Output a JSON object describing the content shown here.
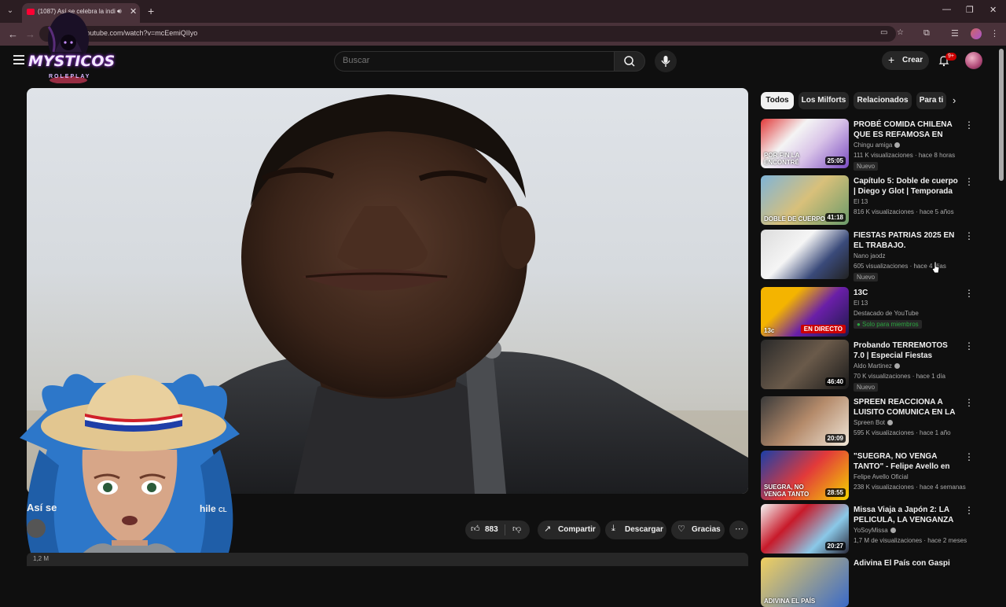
{
  "browser": {
    "tab_title": "(1087) Así se celebra la indi",
    "url": "youtube.com/watch?v=mcEemiQIIyo"
  },
  "overlay_logo": {
    "title": "MYSTICOS",
    "subtitle": "ROLEPLAY"
  },
  "header": {
    "search_placeholder": "Buscar",
    "create_label": "Crear",
    "notification_count": "9+"
  },
  "video": {
    "title_start": "Así se",
    "title_end": "hile",
    "title_tail_badge": "CL",
    "likes": "883",
    "share_label": "Compartir",
    "download_label": "Descargar",
    "thanks_label": "Gracias",
    "description_snippet": "1,2 M"
  },
  "chips": [
    "Todos",
    "Los Milforts",
    "Relacionados",
    "Para ti"
  ],
  "recommendations": [
    {
      "title": "PROBÉ COMIDA CHILENA QUE ES REFAMOSA EN COREA! Y ...",
      "channel": "Chingu amiga",
      "verified": true,
      "meta": "111 K visualizaciones · hace 8 horas",
      "duration": "25:05",
      "badge": "Nuevo",
      "thumb_text": "POR FIN LA ENCONTRÉ"
    },
    {
      "title": "Capítulo 5: Doble de cuerpo | Diego y Glot | Temporada 2005",
      "channel": "El 13",
      "verified": false,
      "meta": "816 K visualizaciones · hace 5 años",
      "duration": "41:18",
      "badge": "",
      "thumb_text": "DOBLE DE CUERPO"
    },
    {
      "title": "FIESTAS PATRIAS 2025 EN EL TRABAJO.",
      "channel": "Nano jaodz",
      "verified": false,
      "meta": "605 visualizaciones · hace 4 días",
      "duration": "",
      "badge": "Nuevo",
      "thumb_text": ""
    },
    {
      "title": "13C",
      "channel": "El 13",
      "verified": false,
      "meta": "Destacado de YouTube",
      "duration": "",
      "live": "EN DIRECTO",
      "member": "Solo para miembros",
      "badge": "",
      "thumb_text": "13c"
    },
    {
      "title": "Probando TERREMOTOS 7.0 | Especial Fiestas Patrias 2025",
      "channel": "Aldo Martinez",
      "verified": true,
      "meta": "70 K visualizaciones · hace 1 día",
      "duration": "46:40",
      "badge": "Nuevo",
      "thumb_text": ""
    },
    {
      "title": "SPREEN REACCIONA A LUISITO COMUNICA EN LA ISLA DE ...",
      "channel": "Spreen Bot",
      "verified": true,
      "meta": "595 K visualizaciones · hace 1 año",
      "duration": "20:09",
      "badge": "",
      "thumb_text": ""
    },
    {
      "title": "\"SUEGRA, NO VENGA TANTO\" - Felipe Avello en vivo desde ...",
      "channel": "Felipe Avello Oficial",
      "verified": false,
      "meta": "238 K visualizaciones · hace 4 semanas",
      "duration": "28:55",
      "badge": "",
      "thumb_text": "SUEGRA, NO VENGA TANTO"
    },
    {
      "title": "Missa Viaja a Japón 2: LA PELICULA, LA VENGANZA DE...",
      "channel": "YoSoyMissa",
      "verified": true,
      "meta": "1,7 M de visualizaciones · hace 2 meses",
      "duration": "20:27",
      "badge": "",
      "thumb_text": ""
    },
    {
      "title": "Adivina El País con Gaspi",
      "channel": "",
      "verified": false,
      "meta": "",
      "duration": "",
      "badge": "",
      "thumb_text": "ADIVINA EL PAÍS"
    }
  ],
  "colors": {
    "background": "#0f0f0f",
    "chip_bg": "#272727",
    "accent_red": "#cc0000",
    "member_green": "#2ba640",
    "chrome_tab": "#4a323a"
  }
}
